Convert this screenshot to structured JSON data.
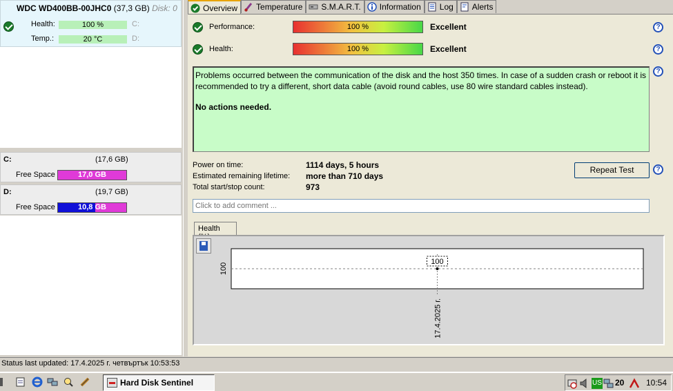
{
  "disk": {
    "name": "WDC WD400BB-00JHC0",
    "size": "(37,3 GB)",
    "disk_label": "Disk: 0",
    "health_label": "Health:",
    "health_value": "100 %",
    "temp_label": "Temp.:",
    "temp_value": "20 °C",
    "drive_c": "C:",
    "drive_d": "D:"
  },
  "volumes": [
    {
      "letter": "C:",
      "size": "(17,6 GB)",
      "free_label": "Free Space",
      "free_value": "17,0 GB",
      "free_fraction": 0.966,
      "fill_color": "#e03ad8"
    },
    {
      "letter": "D:",
      "size": "(19,7 GB)",
      "free_label": "Free Space",
      "free_value": "10,8 GB",
      "free_fraction": 0.548,
      "fill_color": "#1010d8"
    }
  ],
  "tabs": [
    {
      "label": "Overview",
      "icon": "check-circle-icon",
      "active": true
    },
    {
      "label": "Temperature",
      "icon": "thermometer-icon",
      "active": false
    },
    {
      "label": "S.M.A.R.T.",
      "icon": "smart-icon",
      "active": false
    },
    {
      "label": "Information",
      "icon": "info-icon",
      "active": false
    },
    {
      "label": "Log",
      "icon": "log-icon",
      "active": false
    },
    {
      "label": "Alerts",
      "icon": "alerts-icon",
      "active": false
    }
  ],
  "overview": {
    "performance_label": "Performance:",
    "performance_value": "100 %",
    "performance_rating": "Excellent",
    "health_label": "Health:",
    "health_value": "100 %",
    "health_rating": "Excellent",
    "message": "Problems occurred between the communication of the disk and the host 350 times. In case of a sudden crash or reboot it is recommended to try a different, short data cable (avoid round cables, use 80 wire standard cables instead).",
    "action": "No actions needed.",
    "power_on_label": "Power on time:",
    "power_on_value": "1114 days, 5 hours",
    "remaining_label": "Estimated remaining lifetime:",
    "remaining_value": "more than 710 days",
    "startstop_label": "Total start/stop count:",
    "startstop_value": "973",
    "repeat_button": "Repeat Test",
    "comment_placeholder": "Click to add comment ...",
    "help_glyph": "?"
  },
  "chart_tab": "Health (%)",
  "chart_data": {
    "type": "line",
    "title": "",
    "xlabel": "",
    "ylabel": "",
    "x": [
      "17.4.2025 г."
    ],
    "series": [
      {
        "values": [
          100
        ]
      }
    ],
    "data_labels": [
      "100"
    ],
    "y_ticks": [
      "100"
    ],
    "grid": true,
    "colors": {
      "point": "#000000",
      "gridline": "#808080",
      "plot_bg": "#ffffff"
    }
  },
  "statusbar": {
    "text": "Status last updated: 17.4.2025 г. четвъртък 10:53:53"
  },
  "taskbar": {
    "task_label": "Hard Disk Sentinel",
    "lang": "US",
    "tray_temp": "20",
    "clock": "10:54"
  }
}
